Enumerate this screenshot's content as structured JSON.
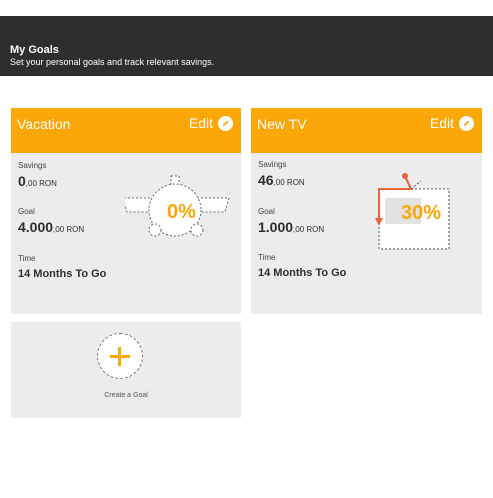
{
  "header": {
    "title": "My Goals",
    "subtitle": "Set your personal goals and track relevant savings."
  },
  "goals": [
    {
      "name": "Vacation",
      "edit_label": "Edit",
      "savings_label": "Savings",
      "savings_value": "0",
      "savings_decimals": ",00 RON",
      "goal_label": "Goal",
      "goal_value": "4.000",
      "goal_decimals": ",00 RON",
      "time_label": "Time",
      "time_value": "14 Months To Go",
      "progress": "0%",
      "icon": "airplane-icon"
    },
    {
      "name": "New TV",
      "edit_label": "Edit",
      "savings_label": "Savings",
      "savings_value": "46",
      "savings_decimals": ",00 RON",
      "goal_label": "Goal",
      "goal_value": "1.000",
      "goal_decimals": ",00 RON",
      "time_label": "Time",
      "time_value": "14 Months To Go",
      "progress": "30%",
      "icon": "tv-icon"
    }
  ],
  "create": {
    "label": "Create a Goal"
  },
  "colors": {
    "accent": "#fba707",
    "header_bg": "#2e2e2e",
    "card_bg": "#ececec",
    "tv_progress": "#e8633a"
  }
}
